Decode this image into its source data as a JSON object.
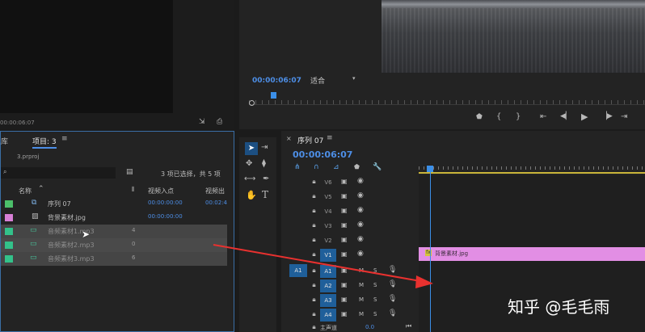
{
  "source_monitor": {
    "timecode": "00:00:06:07"
  },
  "program_monitor": {
    "timecode": "00:00:06:07",
    "zoom_select": "适合"
  },
  "project_panel": {
    "tab_library": "库",
    "tab_project": "项目: 3",
    "file_name": "3.prproj",
    "selection_status": "3 项已选择，共 5 项",
    "columns": {
      "name": "名称",
      "video_in": "视频入点",
      "video_out": "视频出"
    },
    "items": [
      {
        "name": "序列 07",
        "num": "",
        "in": "00:00:00:00",
        "out": "00:02:4",
        "color": "#4cbf6a",
        "selected": false
      },
      {
        "name": "背景素材.jpg",
        "num": "",
        "in": "00:00:00:00",
        "out": "",
        "color": "#d77fd6",
        "selected": false
      },
      {
        "name": "音频素材1.mp3",
        "num": "4",
        "in": "",
        "out": "",
        "color": "#33c28a",
        "selected": true
      },
      {
        "name": "音频素材2.mp3",
        "num": "0",
        "in": "",
        "out": "",
        "color": "#33c28a",
        "selected": true
      },
      {
        "name": "音频素材3.mp3",
        "num": "6",
        "in": "",
        "out": "",
        "color": "#33c28a",
        "selected": true
      }
    ]
  },
  "timeline": {
    "sequence_name": "序列 07",
    "timecode": "00:00:06:07",
    "video_tracks": [
      "V6",
      "V5",
      "V4",
      "V3",
      "V2",
      "V1"
    ],
    "audio_tracks": [
      "A1",
      "A2",
      "A3",
      "A4"
    ],
    "source_patch": "A1",
    "mute_label": "M",
    "solo_label": "S",
    "master_label": "主声道",
    "master_value": "0.0",
    "clip_label": "背景素材.jpg"
  },
  "watermark": "知乎 @毛毛雨",
  "colors": {
    "accent_blue": "#2f8ae5",
    "clip_pink": "#e28ee4",
    "arrow_red": "#e8312f",
    "playhead": "#3b8fe8"
  }
}
